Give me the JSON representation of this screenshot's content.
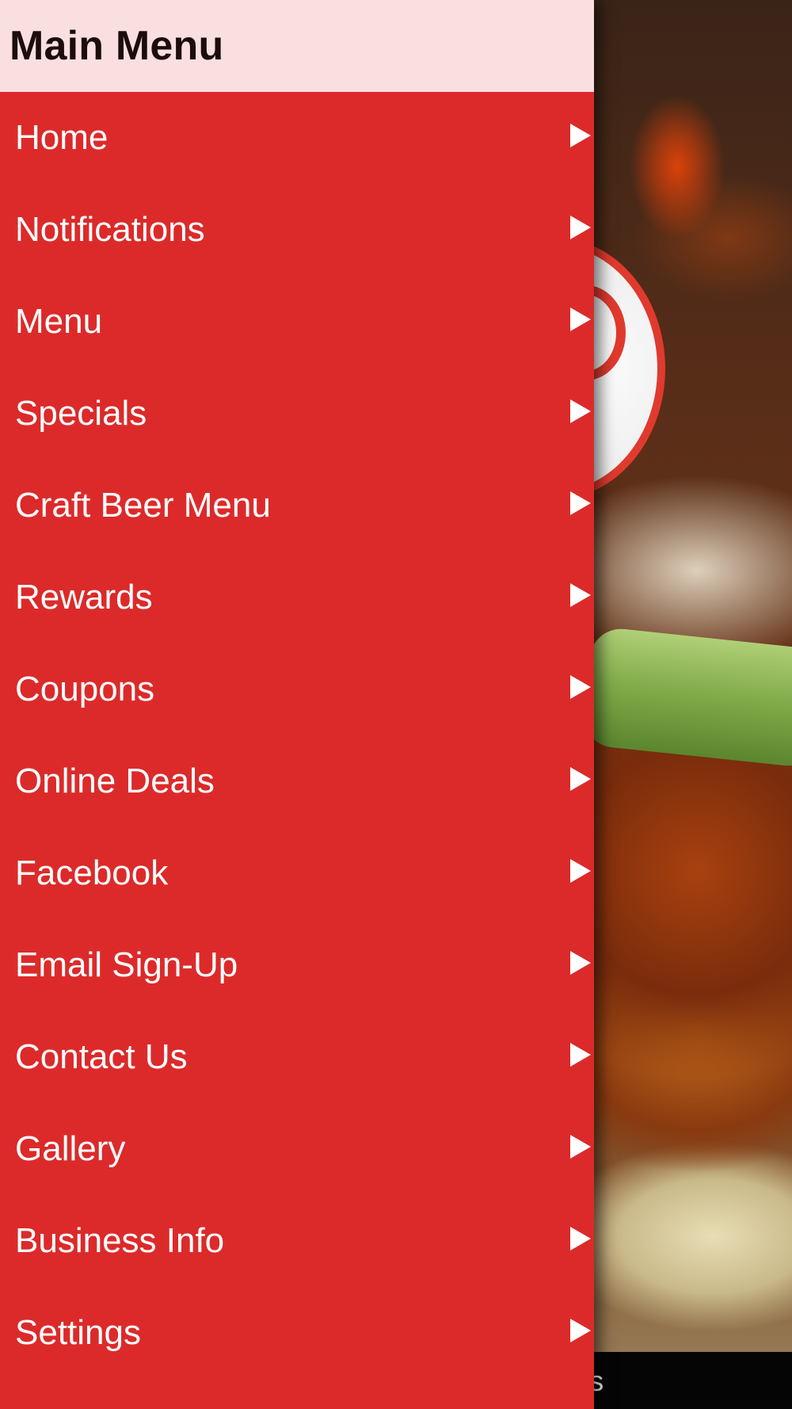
{
  "drawer": {
    "title": "Main Menu",
    "items": [
      {
        "label": "Home",
        "icon": "chevron-right-icon"
      },
      {
        "label": "Notifications",
        "icon": "chevron-right-icon"
      },
      {
        "label": "Menu",
        "icon": "chevron-right-icon"
      },
      {
        "label": "Specials",
        "icon": "chevron-right-icon"
      },
      {
        "label": "Craft Beer Menu",
        "icon": "chevron-right-icon"
      },
      {
        "label": "Rewards",
        "icon": "chevron-right-icon"
      },
      {
        "label": "Coupons",
        "icon": "chevron-right-icon"
      },
      {
        "label": "Online Deals",
        "icon": "chevron-right-icon"
      },
      {
        "label": "Facebook",
        "icon": "chevron-right-icon"
      },
      {
        "label": "Email Sign-Up",
        "icon": "chevron-right-icon"
      },
      {
        "label": "Contact Us",
        "icon": "chevron-right-icon"
      },
      {
        "label": "Gallery",
        "icon": "chevron-right-icon"
      },
      {
        "label": "Business Info",
        "icon": "chevron-right-icon"
      },
      {
        "label": "Settings",
        "icon": "chevron-right-icon"
      }
    ]
  },
  "background": {
    "bottom_bar_text": "fications"
  },
  "colors": {
    "drawer_bg": "#dc2a2a",
    "header_bg": "#f9dfe0",
    "header_text": "#1c0c0c",
    "item_text": "#ffffff",
    "bottom_bar_bg": "#050505"
  }
}
